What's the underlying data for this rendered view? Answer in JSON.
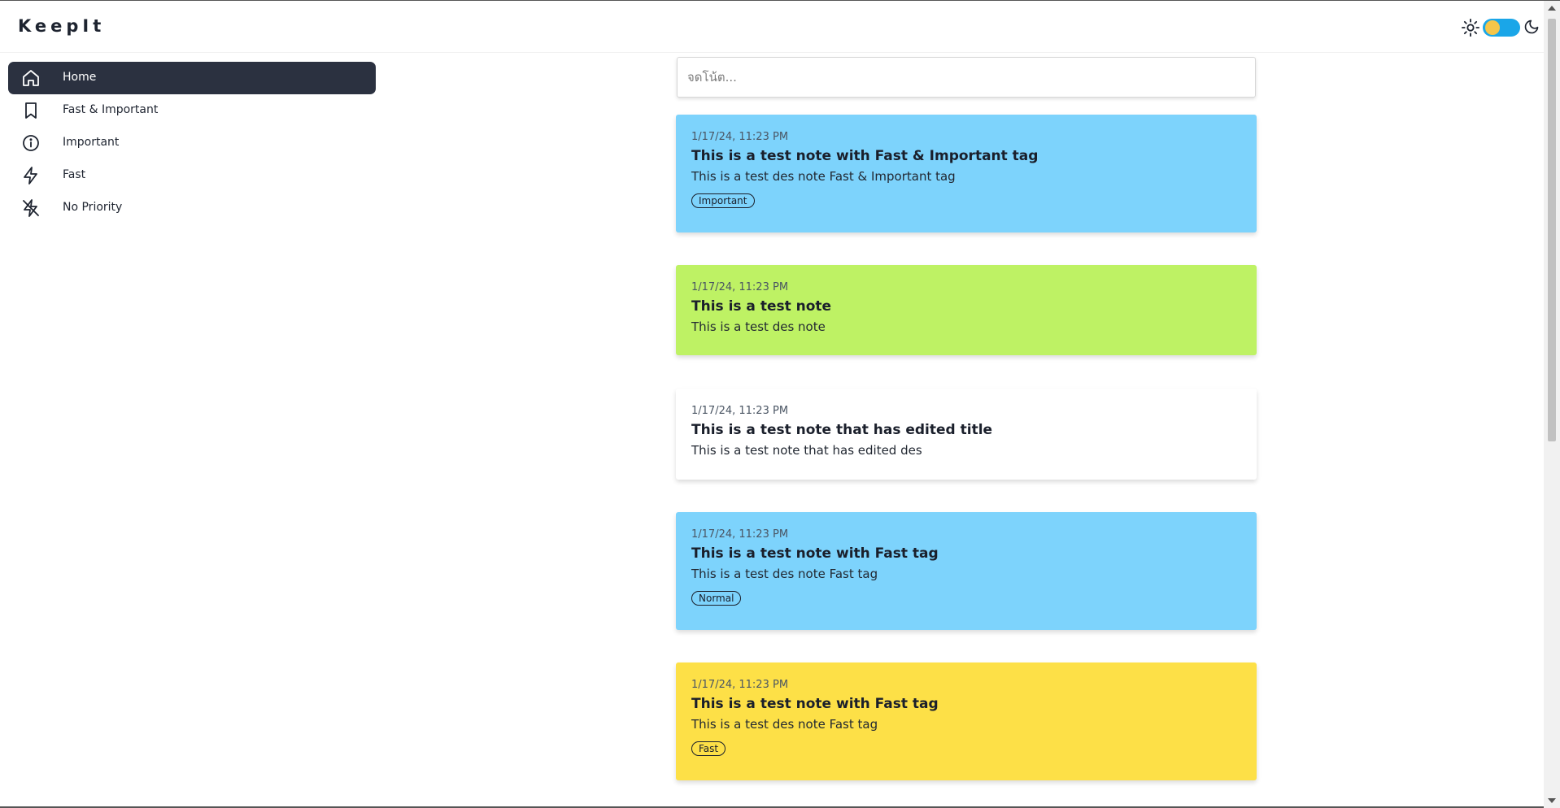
{
  "app": {
    "logo": "KeepIt"
  },
  "theme_toggle": {
    "sun_icon": "sun-icon",
    "moon_icon": "moon-icon",
    "knob_color": "#f5c64a",
    "track_color": "#1aa6e8"
  },
  "sidebar": {
    "items": [
      {
        "label": "Home",
        "icon": "home-icon",
        "active": true
      },
      {
        "label": "Fast & Important",
        "icon": "bookmark-icon",
        "active": false
      },
      {
        "label": "Important",
        "icon": "info-icon",
        "active": false
      },
      {
        "label": "Fast",
        "icon": "lightning-icon",
        "active": false
      },
      {
        "label": "No Priority",
        "icon": "lightning-off-icon",
        "active": false
      }
    ]
  },
  "search": {
    "placeholder": "จดโน้ต..."
  },
  "notes": [
    {
      "date": "1/17/24, 11:23 PM",
      "title": "This is a test note with Fast & Important tag",
      "desc": "This is a test des note Fast & Important tag",
      "tag": "Important",
      "color": "#7dd3fc"
    },
    {
      "date": "1/17/24, 11:23 PM",
      "title": "This is a test note",
      "desc": "This is a test des note",
      "tag": "",
      "color": "#bef264"
    },
    {
      "date": "1/17/24, 11:23 PM",
      "title": "This is a test note that has edited title",
      "desc": "This is a test note that has edited des",
      "tag": "",
      "color": "#ffffff"
    },
    {
      "date": "1/17/24, 11:23 PM",
      "title": "This is a test note with Fast tag",
      "desc": "This is a test des note Fast tag",
      "tag": "Normal",
      "color": "#7dd3fc"
    },
    {
      "date": "1/17/24, 11:23 PM",
      "title": "This is a test note with Fast tag",
      "desc": "This is a test des note Fast tag",
      "tag": "Fast",
      "color": "#fde047"
    }
  ]
}
